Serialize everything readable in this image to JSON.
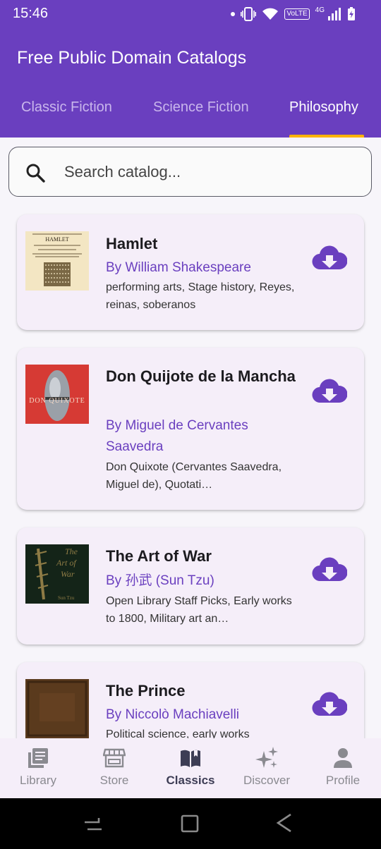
{
  "status": {
    "time": "15:46",
    "volte": "VoLTE",
    "network": "4G"
  },
  "app": {
    "title": "Free Public Domain Catalogs"
  },
  "tabs": [
    {
      "label": "Classic Fiction",
      "active": false
    },
    {
      "label": "Science Fiction",
      "active": false
    },
    {
      "label": "Philosophy",
      "active": true
    }
  ],
  "search": {
    "placeholder": "Search catalog..."
  },
  "books": [
    {
      "title": "Hamlet",
      "author": "By William Shakespeare",
      "subjects": "performing arts, Stage history, Reyes, reinas, soberanos",
      "cover_text": [
        "HAMLET"
      ]
    },
    {
      "title": "Don Quijote de la Mancha",
      "author": "By Miguel de Cervantes Saavedra",
      "subjects": "Don Quixote (Cervantes Saavedra, Miguel de), Quotati…",
      "cover_text": [
        "DON QUIXOTE"
      ]
    },
    {
      "title": "The Art of War",
      "author": "By 孙武 (Sun Tzu)",
      "subjects": "Open Library Staff Picks, Early works to 1800, Military art an…",
      "cover_text": [
        "The",
        "Art of",
        "War",
        "Sun Tzu"
      ]
    },
    {
      "title": "The Prince",
      "author": "By Niccolò Machiavelli",
      "subjects": "Political science, early works"
    }
  ],
  "nav": [
    {
      "label": "Library",
      "icon": "library-icon",
      "active": false
    },
    {
      "label": "Store",
      "icon": "store-icon",
      "active": false
    },
    {
      "label": "Classics",
      "icon": "book-open-icon",
      "active": true
    },
    {
      "label": "Discover",
      "icon": "sparkle-icon",
      "active": false
    },
    {
      "label": "Profile",
      "icon": "person-icon",
      "active": false
    }
  ],
  "colors": {
    "primary": "#6a3fbf",
    "tab_indicator": "#ffb300",
    "card_bg": "#f5eef9"
  }
}
